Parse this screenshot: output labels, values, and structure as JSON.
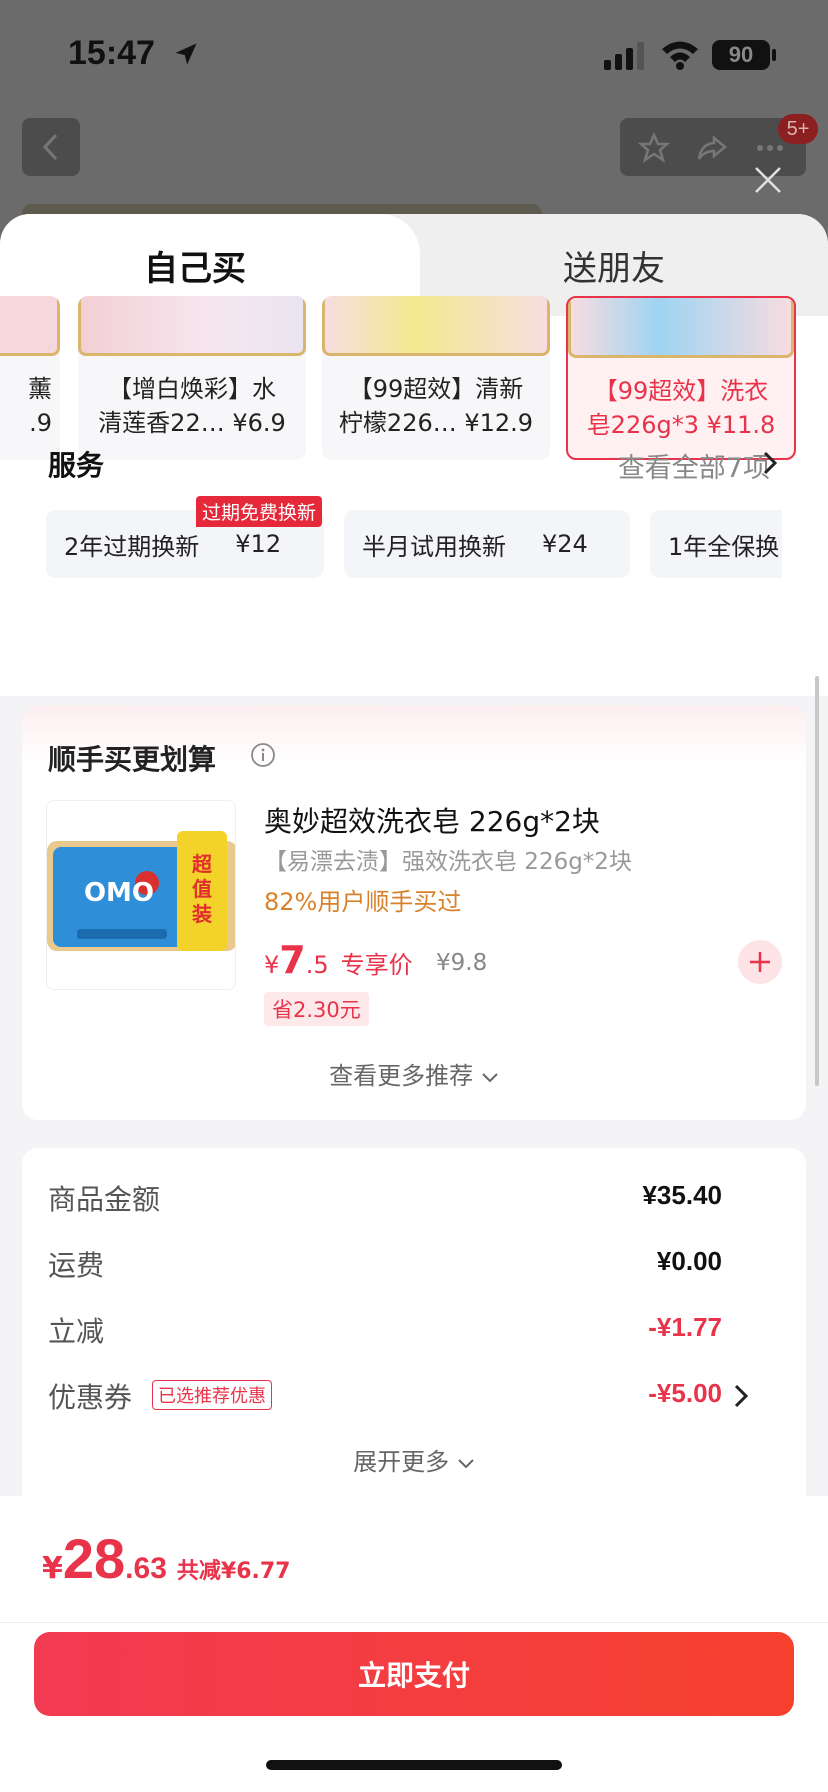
{
  "status_bar": {
    "time": "15:47",
    "battery": "90"
  },
  "header": {
    "badge": "5+"
  },
  "tabs": [
    {
      "label": "自己买",
      "active": true
    },
    {
      "label": "送朋友",
      "active": false
    }
  ],
  "products": [
    {
      "name": "薰\n.9",
      "selected": false
    },
    {
      "name": "【增白焕彩】水\n清莲香22… ¥6.9",
      "selected": false
    },
    {
      "name": "【99超效】清新\n柠檬226… ¥12.9",
      "selected": false
    },
    {
      "name": "【99超效】洗衣\n皂226g*3 ¥11.8",
      "selected": true
    }
  ],
  "services": {
    "title": "服务",
    "view_all": "查看全部7项",
    "tag": "过期免费换新",
    "items": [
      {
        "name": "2年过期换新",
        "price": "¥12"
      },
      {
        "name": "半月试用换新",
        "price": "¥24"
      },
      {
        "name": "1年全保换",
        "price": ""
      }
    ]
  },
  "addon": {
    "title": "顺手买更划算",
    "name": "奥妙超效洗衣皂 226g*2块",
    "subtitle": "【易漂去渍】强效洗衣皂 226g*2块",
    "buyers": "82%用户顺手买过",
    "price_symbol": "¥",
    "price_int": "7",
    "price_dec": ".5",
    "price_label": "专享价",
    "original_price": "¥9.8",
    "saving": "省2.30元",
    "more": "查看更多推荐",
    "image_text": "OMO"
  },
  "summary": {
    "rows": [
      {
        "label": "商品金额",
        "value": "¥35.40",
        "red": false
      },
      {
        "label": "运费",
        "value": "¥0.00",
        "red": false
      },
      {
        "label": "立减",
        "value": "-¥1.77",
        "red": true
      },
      {
        "label": "优惠券",
        "value": "-¥5.00",
        "red": true
      }
    ],
    "coupon_tag": "已选推荐优惠",
    "expand": "展开更多"
  },
  "payment": {
    "symbol": "¥",
    "total_int": "28",
    "total_dec": ".63",
    "discount": "共减¥6.77",
    "button": "立即支付"
  },
  "colors": {
    "accent": "#e8334a",
    "orange": "#d9822b"
  }
}
